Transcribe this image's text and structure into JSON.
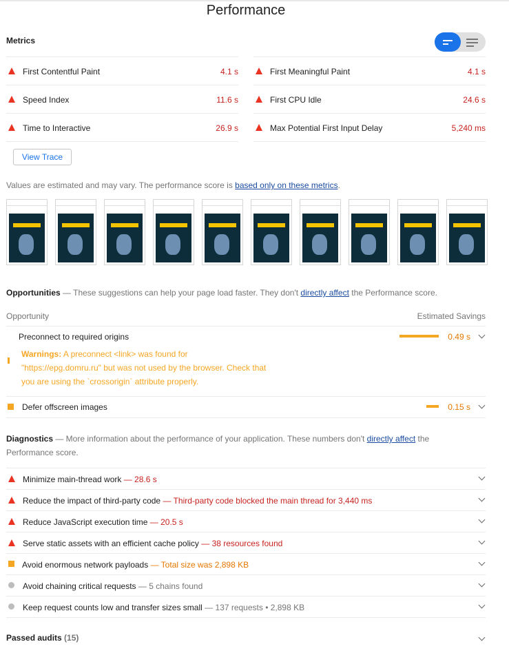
{
  "title": "Performance",
  "metrics": {
    "heading": "Metrics",
    "left": [
      {
        "label": "First Contentful Paint",
        "value": "4.1 s"
      },
      {
        "label": "Speed Index",
        "value": "11.6 s"
      },
      {
        "label": "Time to Interactive",
        "value": "26.9 s"
      }
    ],
    "right": [
      {
        "label": "First Meaningful Paint",
        "value": "4.1 s"
      },
      {
        "label": "First CPU Idle",
        "value": "24.6 s"
      },
      {
        "label": "Max Potential First Input Delay",
        "value": "5,240 ms"
      }
    ],
    "view_trace": "View Trace",
    "note": "Values are estimated and may vary. The performance score is ",
    "note_link": "based only on these metrics",
    "note_end": "."
  },
  "opportunities": {
    "heading": "Opportunities",
    "desc_pre": " — These suggestions can help your page load faster. They don't ",
    "desc_link": "directly affect",
    "desc_post": " the Performance score.",
    "col_left": "Opportunity",
    "col_right": "Estimated Savings",
    "items": [
      {
        "label": "Preconnect to required origins",
        "value": "0.49 s",
        "warning_label": "Warnings:",
        "warning_l1": " A preconnect <link> was found for",
        "warning_l2": "\"https://epg.domru.ru\" but was not used by the browser. Check that",
        "warning_l3": "you are using the `crossorigin` attribute properly."
      },
      {
        "label": "Defer offscreen images",
        "value": "0.15 s"
      }
    ]
  },
  "diagnostics": {
    "heading": "Diagnostics",
    "desc_pre": " — More information about the performance of your application. These numbers don't ",
    "desc_link": "directly affect",
    "desc_post1": " the",
    "desc_post2": "Performance score.",
    "items": [
      {
        "label": "Minimize main-thread work",
        "detail": "— 28.6 s"
      },
      {
        "label": "Reduce the impact of third-party code",
        "detail": "— Third-party code blocked the main thread for 3,440 ms"
      },
      {
        "label": "Reduce JavaScript execution time",
        "detail": "— 20.5 s"
      },
      {
        "label": "Serve static assets with an efficient cache policy",
        "detail": "— 38 resources found"
      },
      {
        "label": "Avoid enormous network payloads",
        "detail": "— Total size was 2,898 KB"
      },
      {
        "label": "Avoid chaining critical requests",
        "detail": "— 5 chains found"
      },
      {
        "label": "Keep request counts low and transfer sizes small",
        "detail": "— 137 requests • 2,898 KB"
      }
    ]
  },
  "passed": {
    "label": "Passed audits",
    "count": "(15)"
  },
  "colors": {
    "fail": "#eb3323",
    "average": "#f5a623",
    "accent": "#1a73e8"
  }
}
